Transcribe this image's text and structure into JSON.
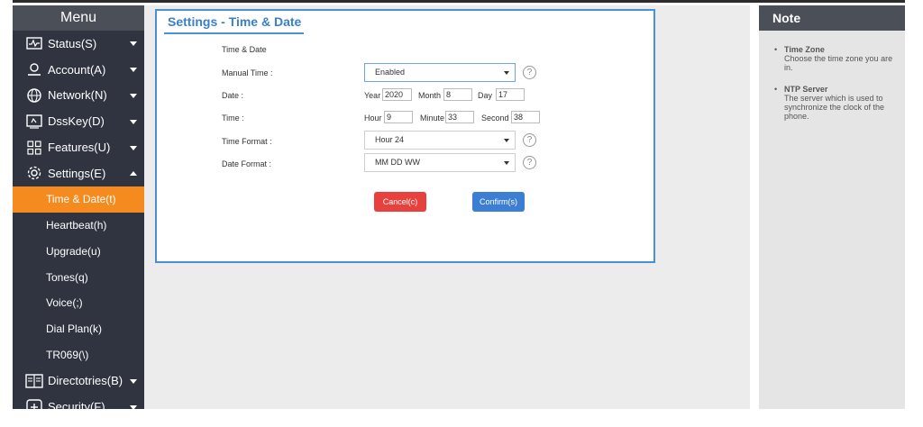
{
  "sidebar": {
    "title": "Menu",
    "items": [
      {
        "label": "Status(S)",
        "icon": "status-icon"
      },
      {
        "label": "Account(A)",
        "icon": "account-icon"
      },
      {
        "label": "Network(N)",
        "icon": "network-icon"
      },
      {
        "label": "DssKey(D)",
        "icon": "dsskey-icon"
      },
      {
        "label": "Features(U)",
        "icon": "features-icon"
      },
      {
        "label": "Settings(E)",
        "icon": "settings-icon"
      }
    ],
    "sub_items": [
      "Time & Date(t)",
      "Heartbeat(h)",
      "Upgrade(u)",
      "Tones(q)",
      "Voice(;)",
      "Dial Plan(k)",
      "TR069(\\)"
    ],
    "bottom_items": [
      {
        "label": "Directotries(B)",
        "icon": "directories-icon"
      },
      {
        "label": "Security(F)",
        "icon": "security-icon"
      }
    ]
  },
  "panel": {
    "title": "Settings - Time & Date",
    "section_label": "Time & Date",
    "manual_time": {
      "label": "Manual Time :",
      "value": "Enabled"
    },
    "date": {
      "label": "Date :",
      "year_label": "Year",
      "year": "2020",
      "month_label": "Month",
      "month": "8",
      "day_label": "Day",
      "day": "17"
    },
    "time": {
      "label": "Time :",
      "hour_label": "Hour",
      "hour": "9",
      "minute_label": "Minute",
      "minute": "33",
      "second_label": "Second",
      "second": "38"
    },
    "time_format": {
      "label": "Time Format :",
      "value": "Hour 24"
    },
    "date_format": {
      "label": "Date Format :",
      "value": "MM DD WW"
    },
    "help_glyph": "?",
    "cancel_label": "Cancel(c)",
    "confirm_label": "Confirm(s)"
  },
  "note": {
    "title": "Note",
    "items": [
      {
        "title": "Time Zone",
        "desc": "Choose the time zone you are in."
      },
      {
        "title": "NTP Server",
        "desc": "The server which is used to synchronize the clock of the phone."
      }
    ]
  },
  "colors": {
    "sidebar_bg": "#2f3440",
    "active": "#f58a1f",
    "cancel": "#e8403c",
    "confirm": "#3b7ed3",
    "accent": "#4a90d9"
  }
}
